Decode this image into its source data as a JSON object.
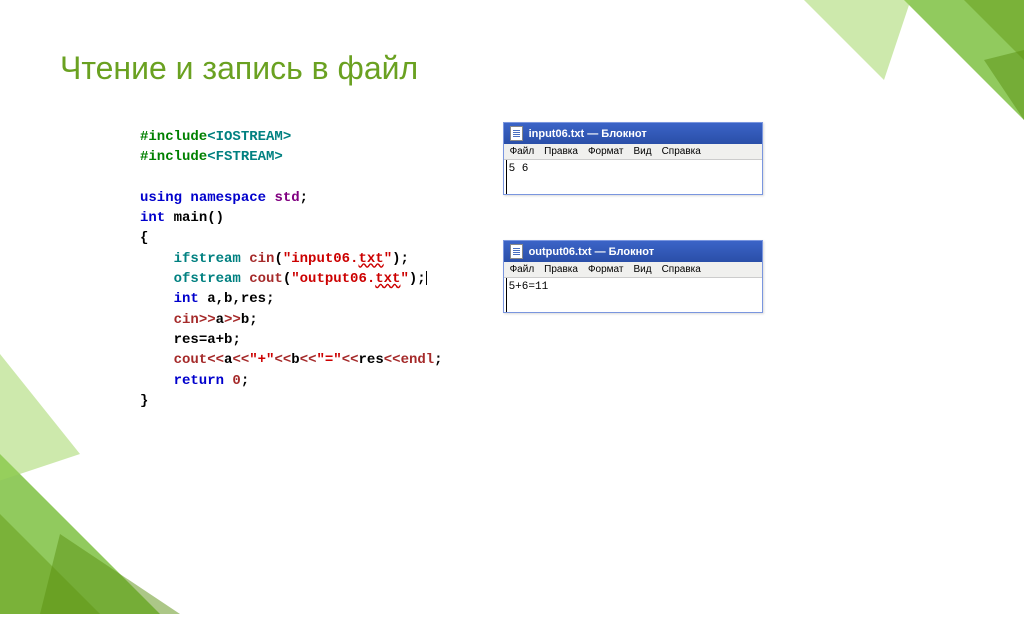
{
  "slide": {
    "title": "Чтение и запись в файл"
  },
  "code": {
    "l1a": "#include",
    "l1b": "<IOSTREAM>",
    "l2a": "#include",
    "l2b": "<FSTREAM>",
    "l4a": "using",
    "l4b": " namespace ",
    "l4c": "std",
    "l4d": ";",
    "l5a": "int",
    "l5b": " main",
    "l5c": "()",
    "l6": "{",
    "l7a": "    ifstream ",
    "l7b": "cin",
    "l7c": "(",
    "l7d": "\"input06.",
    "l7e": "txt",
    "l7f": "\"",
    "l7g": ")",
    "l7h": ";",
    "l8a": "    ofstream ",
    "l8b": "cout",
    "l8c": "(",
    "l8d": "\"output06.",
    "l8e": "txt",
    "l8f": "\"",
    "l8g": ")",
    "l8h": ";",
    "l9a": "    int",
    "l9b": " a",
    "l9c": ",",
    "l9d": "b",
    "l9e": ",",
    "l9f": "res",
    "l9g": ";",
    "l10a": "    cin",
    "l10b": ">>",
    "l10c": "a",
    "l10d": ">>",
    "l10e": "b",
    "l10f": ";",
    "l11a": "    res",
    "l11b": "=",
    "l11c": "a",
    "l11d": "+",
    "l11e": "b",
    "l11f": ";",
    "l12a": "    cout",
    "l12b": "<<",
    "l12c": "a",
    "l12d": "<<",
    "l12e": "\"+\"",
    "l12f": "<<",
    "l12g": "b",
    "l12h": "<<",
    "l12i": "\"=\"",
    "l12j": "<<",
    "l12k": "res",
    "l12l": "<<",
    "l12m": "endl",
    "l12n": ";",
    "l13a": "    return",
    "l13b": " 0",
    "l13c": ";",
    "l14": "}"
  },
  "notepad1": {
    "title": "input06.txt — Блокнот",
    "menu": {
      "file": "Файл",
      "edit": "Правка",
      "format": "Формат",
      "view": "Вид",
      "help": "Справка"
    },
    "body": "5 6"
  },
  "notepad2": {
    "title": "output06.txt — Блокнот",
    "menu": {
      "file": "Файл",
      "edit": "Правка",
      "format": "Формат",
      "view": "Вид",
      "help": "Справка"
    },
    "body": "5+6=11"
  }
}
